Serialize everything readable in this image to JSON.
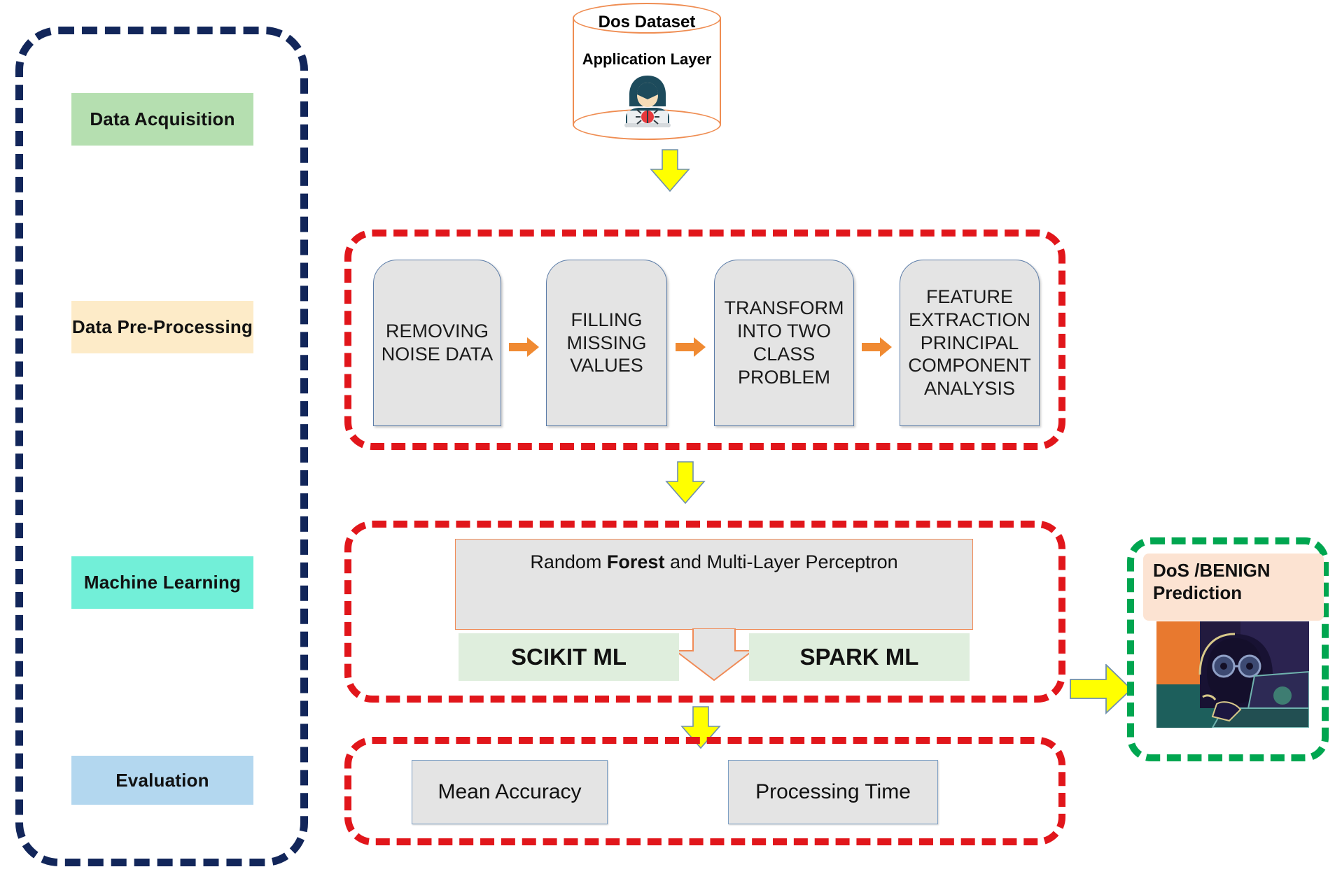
{
  "sidebar": {
    "stages": [
      {
        "label": "Data Acquisition",
        "color": "#b5dfb0"
      },
      {
        "label": "Data Pre-Processing",
        "color": "#fdebc8"
      },
      {
        "label": "Machine Learning",
        "color": "#72efd8"
      },
      {
        "label": "Evaluation",
        "color": "#b3d7ef"
      }
    ]
  },
  "dataset": {
    "title": "Dos Dataset",
    "layer_label": "Application Layer",
    "icon": "hacker-laptop-bug-icon",
    "border_color": "#ef8d52"
  },
  "preprocessing": {
    "container_color": "#e1161b",
    "steps": [
      {
        "line1": "REMOVING",
        "line2": "NOISE DATA",
        "line3": "",
        "line4": "",
        "line5": ""
      },
      {
        "line1": "FILLING",
        "line2": "MISSING",
        "line3": "VALUES",
        "line4": "",
        "line5": ""
      },
      {
        "line1": "TRANSFORM",
        "line2": "INTO TWO",
        "line3": "CLASS",
        "line4": "PROBLEM",
        "line5": ""
      },
      {
        "line1": "FEATURE",
        "line2": "EXTRACTION",
        "line3": "PRINCIPAL",
        "line4": "COMPONENT",
        "line5": "ANALYSIS"
      }
    ],
    "connector_icon": "orange-right-arrow-icon"
  },
  "machine_learning": {
    "container_color": "#e1161b",
    "algorithms_prefix": "Random ",
    "algorithms_emphasis": "Forest",
    "algorithms_suffix": "  and Multi-Layer Perceptron",
    "libraries": [
      {
        "label": "SCIKIT ML"
      },
      {
        "label": "SPARK ML"
      }
    ],
    "split_arrow_icon": "gray-down-arrow-icon"
  },
  "evaluation": {
    "container_color": "#e1161b",
    "metrics": [
      {
        "label": "Mean Accuracy"
      },
      {
        "label": "Processing Time"
      }
    ]
  },
  "prediction": {
    "title_line1": "DoS /BENIGN",
    "title_line2": "Prediction",
    "border_color": "#00a650",
    "label_bg": "#fce3d2",
    "image_icon": "hooded-hacker-laptop-illustration"
  },
  "flow_arrows": {
    "down_icon": "yellow-down-arrow-icon",
    "right_icon": "yellow-right-arrow-icon",
    "count_down": 3,
    "count_right": 1
  }
}
